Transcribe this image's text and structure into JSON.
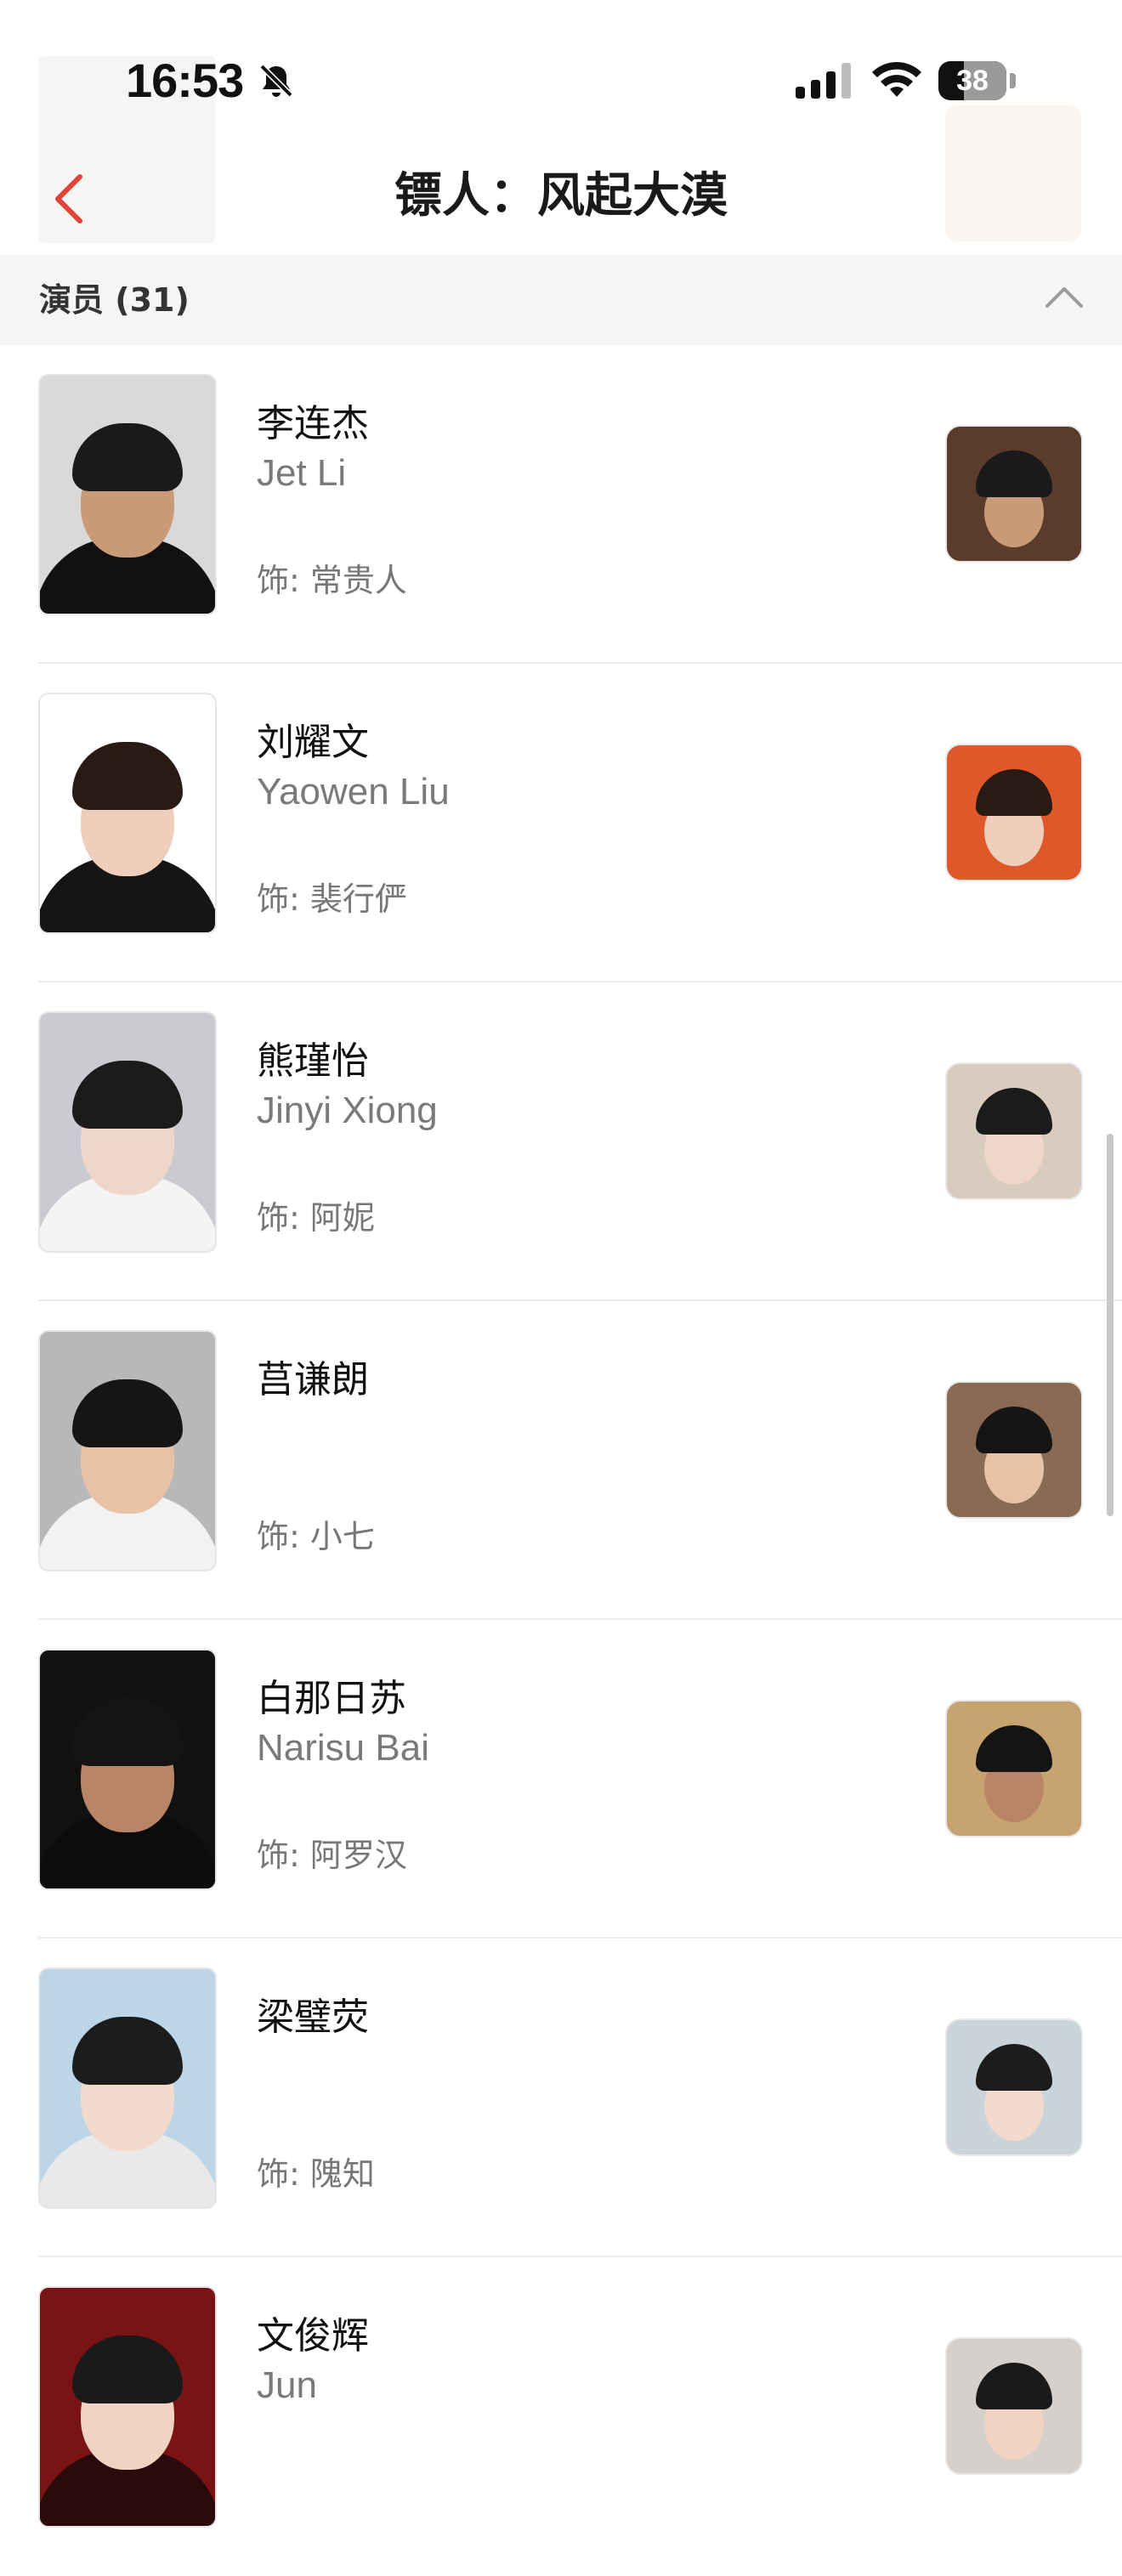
{
  "status_bar": {
    "time": "16:53",
    "battery": "38",
    "battery_level": 0.38
  },
  "header": {
    "title": "镖人：风起大漠"
  },
  "section": {
    "label": "演员 (31)"
  },
  "cast": [
    {
      "name_cn": "李连杰",
      "name_en": "Jet Li",
      "role": "饰: 常贵人",
      "photo_bg": "#d9d9d9",
      "skin": "#c99a78",
      "hair": "#1a1a1a",
      "outfit": "#111111",
      "still_bg": "#5a3b2c"
    },
    {
      "name_cn": "刘耀文",
      "name_en": "Yaowen Liu",
      "role": "饰: 裴行俨",
      "photo_bg": "#ffffff",
      "skin": "#efcfbb",
      "hair": "#2a1a14",
      "outfit": "#151515",
      "still_bg": "#e0582a"
    },
    {
      "name_cn": "熊瑾怡",
      "name_en": "Jinyi Xiong",
      "role": "饰: 阿妮",
      "photo_bg": "#c9cbd0",
      "skin": "#f0d6c8",
      "hair": "#1b1b1b",
      "outfit": "#f4f4f4",
      "still_bg": "#d8ccbe"
    },
    {
      "name_cn": "莒谦朗",
      "name_en": "",
      "role": "饰: 小七",
      "photo_bg": "#b8b8b8",
      "skin": "#e7c2a7",
      "hair": "#151515",
      "outfit": "#f2f2f2",
      "still_bg": "#8a6a52"
    },
    {
      "name_cn": "白那日苏",
      "name_en": "Narisu Bai",
      "role": "饰: 阿罗汉",
      "photo_bg": "#111111",
      "skin": "#b88567",
      "hair": "#141414",
      "outfit": "#0c0c0c",
      "still_bg": "#c7a370"
    },
    {
      "name_cn": "梁璧荧",
      "name_en": "",
      "role": "饰: 隗知",
      "photo_bg": "#bcd6e8",
      "skin": "#f3dacd",
      "hair": "#1c1c1c",
      "outfit": "#e9e9e9",
      "still_bg": "#c9d4da"
    },
    {
      "name_cn": "文俊辉",
      "name_en": "Jun",
      "role": "",
      "photo_bg": "#7a1414",
      "skin": "#f0d3c3",
      "hair": "#1a1a1a",
      "outfit": "#2a0a0a",
      "still_bg": "#d6d0cc"
    }
  ]
}
